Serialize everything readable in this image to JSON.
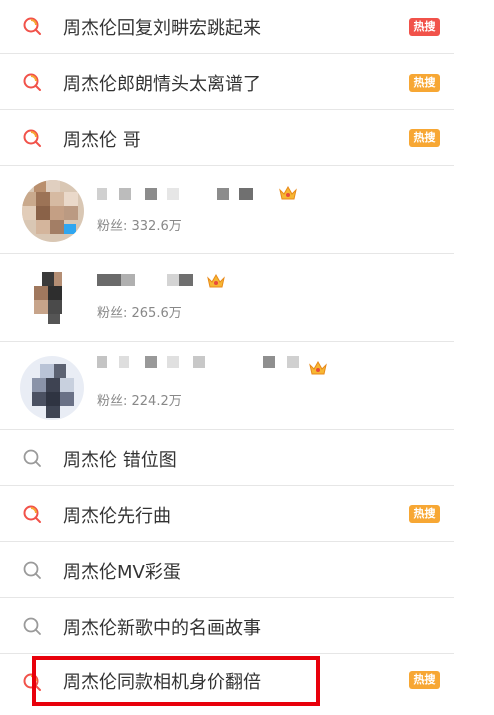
{
  "suggestions_top": [
    {
      "label": "周杰伦回复刘畊宏跳起来",
      "badge": "热搜",
      "badge_color": "#f1524a",
      "icon": "hot-search-icon"
    },
    {
      "label": "周杰伦郎朗情头太离谱了",
      "badge": "热搜",
      "badge_color": "#f7a734",
      "icon": "hot-search-icon"
    },
    {
      "label": "周杰伦 哥",
      "badge": "热搜",
      "badge_color": "#f7a734",
      "icon": "hot-search-icon"
    }
  ],
  "users": [
    {
      "fans": "粉丝: 332.6万",
      "verified": "crown-icon"
    },
    {
      "fans": "粉丝: 265.6万",
      "verified": "crown-icon"
    },
    {
      "fans": "粉丝: 224.2万",
      "verified": "crown-icon"
    }
  ],
  "suggestions_bottom": [
    {
      "label": "周杰伦 错位图",
      "badge": "",
      "icon": "search-icon"
    },
    {
      "label": "周杰伦先行曲",
      "badge": "热搜",
      "badge_color": "#f7a734",
      "icon": "hot-search-icon"
    },
    {
      "label": "周杰伦MV彩蛋",
      "badge": "",
      "icon": "search-icon"
    },
    {
      "label": "周杰伦新歌中的名画故事",
      "badge": "",
      "icon": "search-icon"
    },
    {
      "label": "周杰伦同款相机身价翻倍",
      "badge": "热搜",
      "badge_color": "#f7a734",
      "icon": "hot-search-icon"
    }
  ],
  "colors": {
    "hot_red": "#f1524a",
    "hot_orange": "#f7a734",
    "highlight": "#e8000b"
  }
}
